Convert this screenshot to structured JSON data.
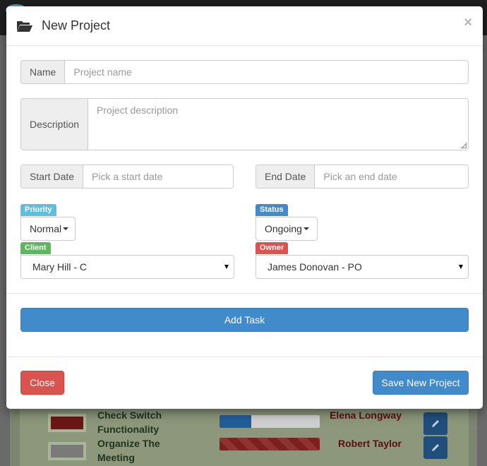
{
  "modal": {
    "title": "New Project",
    "close_symbol": "×",
    "icons": {
      "header": "folder-open-icon"
    }
  },
  "form": {
    "name": {
      "label": "Name",
      "placeholder": "Project name",
      "value": ""
    },
    "description": {
      "label": "Description",
      "placeholder": "Project description",
      "value": ""
    },
    "start_date": {
      "label": "Start Date",
      "placeholder": "Pick a start date",
      "value": ""
    },
    "end_date": {
      "label": "End Date",
      "placeholder": "Pick an end date",
      "value": ""
    },
    "priority": {
      "badge": "Priority",
      "value": "Normal",
      "badge_color": "#5bc0de"
    },
    "status": {
      "badge": "Status",
      "value": "Ongoing",
      "badge_color": "#428bca"
    },
    "client": {
      "badge": "Client",
      "value": "Mary Hill - C",
      "badge_color": "#5cb85c"
    },
    "owner": {
      "badge": "Owner",
      "value": "James Donovan - PO",
      "badge_color": "#d9534f"
    },
    "add_task_label": "Add Task"
  },
  "footer": {
    "close_label": "Close",
    "save_label": "Save New Project"
  },
  "background": {
    "tasks": [
      {
        "title": "Check Switch Functionality",
        "person": "Elena Longway",
        "swatch_color": "#7a1616",
        "progress": 0.32,
        "progress_color": "#2a6bb0"
      },
      {
        "title": "Organize The Meeting",
        "person": "Robert Taylor",
        "swatch_color": "#8a8a8a",
        "progress": 1.0,
        "progress_color": "#8a2323"
      }
    ]
  },
  "colors": {
    "primary": "#428bca",
    "danger": "#d9534f",
    "success": "#5cb85c",
    "info": "#5bc0de"
  }
}
